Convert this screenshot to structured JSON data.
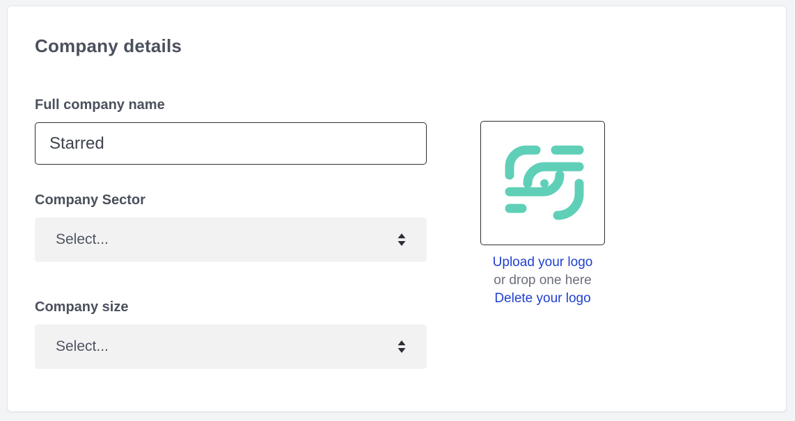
{
  "form": {
    "title": "Company details",
    "company_name": {
      "label": "Full company name",
      "value": "Starred"
    },
    "sector": {
      "label": "Company Sector",
      "selected": "Select..."
    },
    "size": {
      "label": "Company size",
      "selected": "Select..."
    }
  },
  "logo": {
    "icon": "starred-logo-icon",
    "brand_color": "#5fcfb8",
    "upload_label": "Upload your logo",
    "drop_hint": "or drop one here",
    "delete_label": "Delete your logo"
  },
  "colors": {
    "link": "#1f3fd1",
    "heading": "#4b505d",
    "select_bg": "#f2f2f3"
  }
}
